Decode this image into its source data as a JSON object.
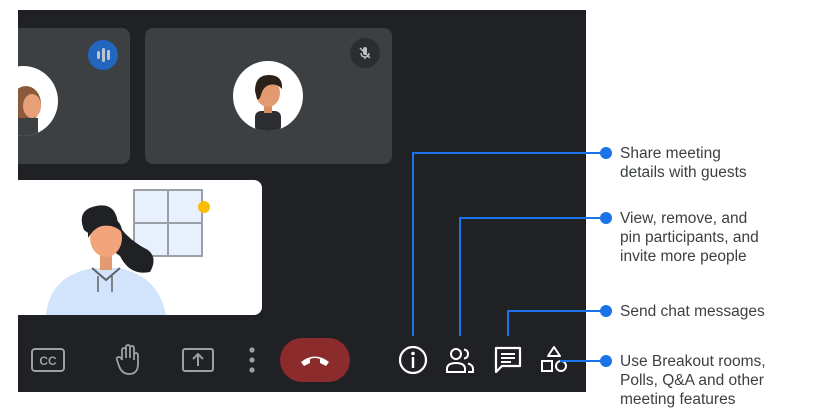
{
  "participants": {
    "left_tile": {
      "status": "speaking"
    },
    "right_tile": {
      "status": "muted"
    },
    "self_tile": {
      "status": "presenting-view"
    }
  },
  "toolbar": {
    "icons": [
      "captions-icon",
      "raise-hand-icon",
      "present-screen-icon",
      "more-options-icon",
      "hang-up-icon",
      "meeting-details-icon",
      "people-icon",
      "chat-icon",
      "activities-icon"
    ]
  },
  "callouts": [
    {
      "text": "Share meeting\ndetails with guests",
      "points_to": "meeting-details-icon"
    },
    {
      "text": "View, remove, and\npin participants, and\ninvite more people",
      "points_to": "people-icon"
    },
    {
      "text": "Send chat messages",
      "points_to": "chat-icon"
    },
    {
      "text": "Use Breakout rooms,\nPolls, Q&A and other\nmeeting features",
      "points_to": "activities-icon"
    }
  ],
  "colors": {
    "meeting_background": "#202124",
    "tile_background": "#3c4043",
    "accent_blue": "#1a73e8",
    "hang_up_red": "#8b2b2b",
    "callout_text": "#3c4043"
  }
}
